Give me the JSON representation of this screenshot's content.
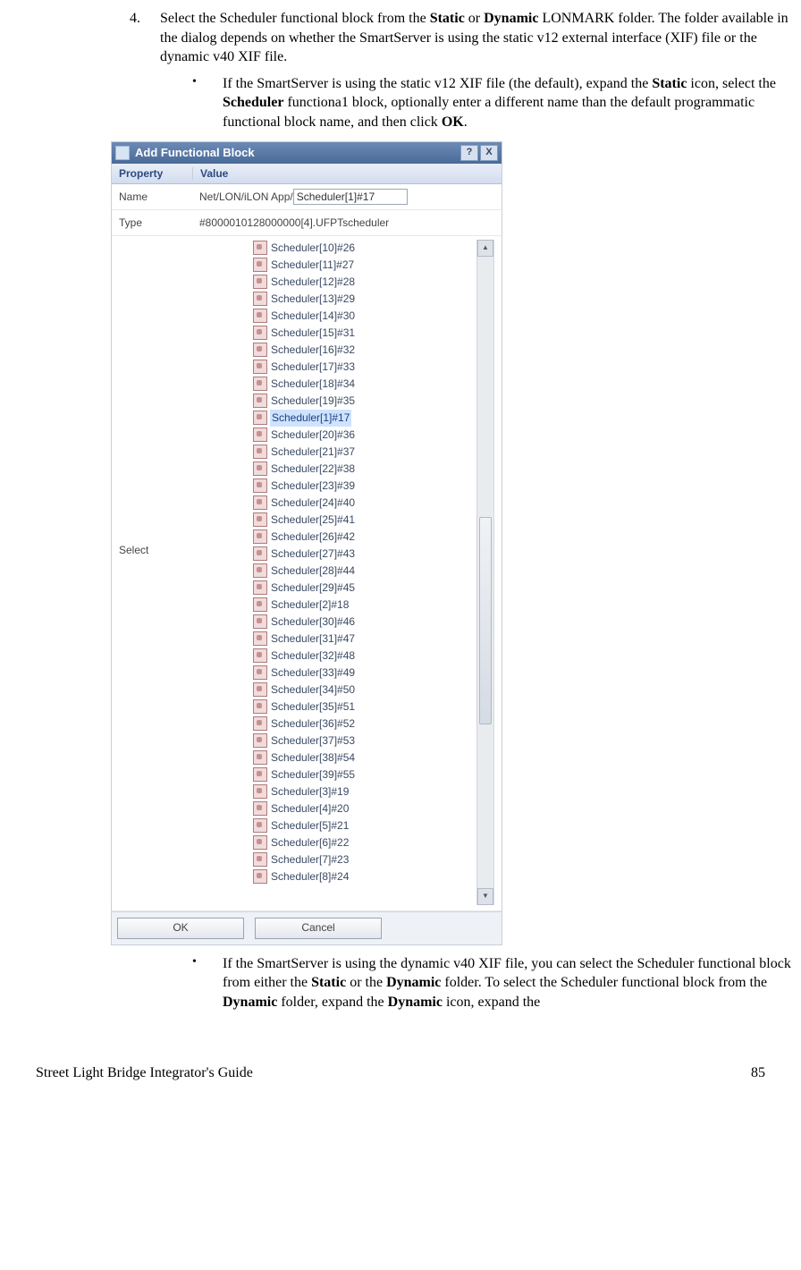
{
  "step_number": "4.",
  "step_text_parts": {
    "p1": "Select the Scheduler functional block from the ",
    "b1": "Static",
    "p2": " or ",
    "b2": "Dynamic",
    "p3": " L",
    "sc": "ONMARK",
    "p4": " folder.  The folder available in the dialog depends on whether the SmartServer is using the static v12 external interface (XIF) file or the dynamic v40 XIF file."
  },
  "bullet1_parts": {
    "p1": "If the SmartServer is using the static v12 XIF file (the default), expand the ",
    "b1": "Static",
    "p2": " icon, select the ",
    "b2": "Scheduler",
    "p3": " functiona1 block, optionally enter a different name than the default programmatic functional block name, and then click ",
    "b3": "OK",
    "p4": "."
  },
  "bullet2_parts": {
    "p1": "If the SmartServer is using the dynamic v40 XIF file, you can select the Scheduler functional block from either the ",
    "b1": "Static",
    "p2": " or the ",
    "b2": "Dynamic",
    "p3": " folder.  To select the Scheduler functional block from the ",
    "b3": "Dynamic",
    "p4": " folder, expand the ",
    "b4": "Dynamic",
    "p5": " icon, expand the"
  },
  "dialog": {
    "title": "Add Functional Block",
    "help": "?",
    "close": "X",
    "header_prop": "Property",
    "header_val": "Value",
    "row_name_label": "Name",
    "row_name_prefix": "Net/LON/iLON App/",
    "row_name_value": "Scheduler[1]#17",
    "row_type_label": "Type",
    "row_type_value": "#8000010128000000[4].UFPTscheduler",
    "row_select_label": "Select",
    "ok": "OK",
    "cancel": "Cancel",
    "tree_items": [
      {
        "label": "Scheduler[10]#26",
        "sel": false
      },
      {
        "label": "Scheduler[11]#27",
        "sel": false
      },
      {
        "label": "Scheduler[12]#28",
        "sel": false
      },
      {
        "label": "Scheduler[13]#29",
        "sel": false
      },
      {
        "label": "Scheduler[14]#30",
        "sel": false
      },
      {
        "label": "Scheduler[15]#31",
        "sel": false
      },
      {
        "label": "Scheduler[16]#32",
        "sel": false
      },
      {
        "label": "Scheduler[17]#33",
        "sel": false
      },
      {
        "label": "Scheduler[18]#34",
        "sel": false
      },
      {
        "label": "Scheduler[19]#35",
        "sel": false
      },
      {
        "label": "Scheduler[1]#17",
        "sel": true
      },
      {
        "label": "Scheduler[20]#36",
        "sel": false
      },
      {
        "label": "Scheduler[21]#37",
        "sel": false
      },
      {
        "label": "Scheduler[22]#38",
        "sel": false
      },
      {
        "label": "Scheduler[23]#39",
        "sel": false
      },
      {
        "label": "Scheduler[24]#40",
        "sel": false
      },
      {
        "label": "Scheduler[25]#41",
        "sel": false
      },
      {
        "label": "Scheduler[26]#42",
        "sel": false
      },
      {
        "label": "Scheduler[27]#43",
        "sel": false
      },
      {
        "label": "Scheduler[28]#44",
        "sel": false
      },
      {
        "label": "Scheduler[29]#45",
        "sel": false
      },
      {
        "label": "Scheduler[2]#18",
        "sel": false
      },
      {
        "label": "Scheduler[30]#46",
        "sel": false
      },
      {
        "label": "Scheduler[31]#47",
        "sel": false
      },
      {
        "label": "Scheduler[32]#48",
        "sel": false
      },
      {
        "label": "Scheduler[33]#49",
        "sel": false
      },
      {
        "label": "Scheduler[34]#50",
        "sel": false
      },
      {
        "label": "Scheduler[35]#51",
        "sel": false
      },
      {
        "label": "Scheduler[36]#52",
        "sel": false
      },
      {
        "label": "Scheduler[37]#53",
        "sel": false
      },
      {
        "label": "Scheduler[38]#54",
        "sel": false
      },
      {
        "label": "Scheduler[39]#55",
        "sel": false
      },
      {
        "label": "Scheduler[3]#19",
        "sel": false
      },
      {
        "label": "Scheduler[4]#20",
        "sel": false
      },
      {
        "label": "Scheduler[5]#21",
        "sel": false
      },
      {
        "label": "Scheduler[6]#22",
        "sel": false
      },
      {
        "label": "Scheduler[7]#23",
        "sel": false
      },
      {
        "label": "Scheduler[8]#24",
        "sel": false
      }
    ]
  },
  "footer_left": "Street Light Bridge Integrator's Guide",
  "footer_right": "85"
}
